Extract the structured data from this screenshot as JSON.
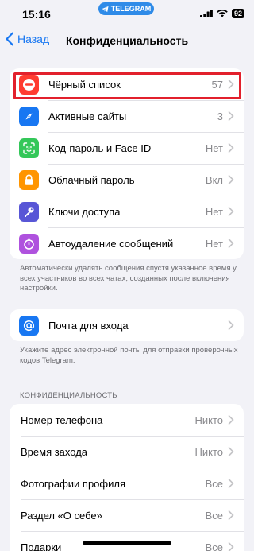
{
  "status": {
    "time": "15:16",
    "app_pill": "TELEGRAM",
    "battery": "92"
  },
  "nav": {
    "back_label": "Назад",
    "title": "Конфиденциальность"
  },
  "security_rows": [
    {
      "label": "Чёрный список",
      "value": "57",
      "icon": "minus-circle-icon",
      "color": "#ff3b30"
    },
    {
      "label": "Активные сайты",
      "value": "3",
      "icon": "compass-icon",
      "color": "#1877f2"
    },
    {
      "label": "Код-пароль и Face ID",
      "value": "Нет",
      "icon": "face-id-icon",
      "color": "#34c759"
    },
    {
      "label": "Облачный пароль",
      "value": "Вкл",
      "icon": "lock-icon",
      "color": "#ff9500"
    },
    {
      "label": "Ключи доступа",
      "value": "Нет",
      "icon": "key-icon",
      "color": "#5856d6"
    },
    {
      "label": "Автоудаление сообщений",
      "value": "Нет",
      "icon": "timer-icon",
      "color": "#af52de"
    }
  ],
  "autodelete_footnote": "Автоматически удалять сообщения спустя указанное время у всех участников во всех чатах, созданных после включения настройки.",
  "login_email": {
    "label": "Почта для входа",
    "icon": "at-icon",
    "color": "#1877f2"
  },
  "email_footnote": "Укажите адрес электронной почты для отправки проверочных кодов Telegram.",
  "privacy_section": {
    "header": "КОНФИДЕНЦИАЛЬНОСТЬ",
    "rows": [
      {
        "label": "Номер телефона",
        "value": "Никто"
      },
      {
        "label": "Время захода",
        "value": "Никто"
      },
      {
        "label": "Фотографии профиля",
        "value": "Все"
      },
      {
        "label": "Раздел «О себе»",
        "value": "Все"
      },
      {
        "label": "Подарки",
        "value": "Все"
      }
    ]
  }
}
